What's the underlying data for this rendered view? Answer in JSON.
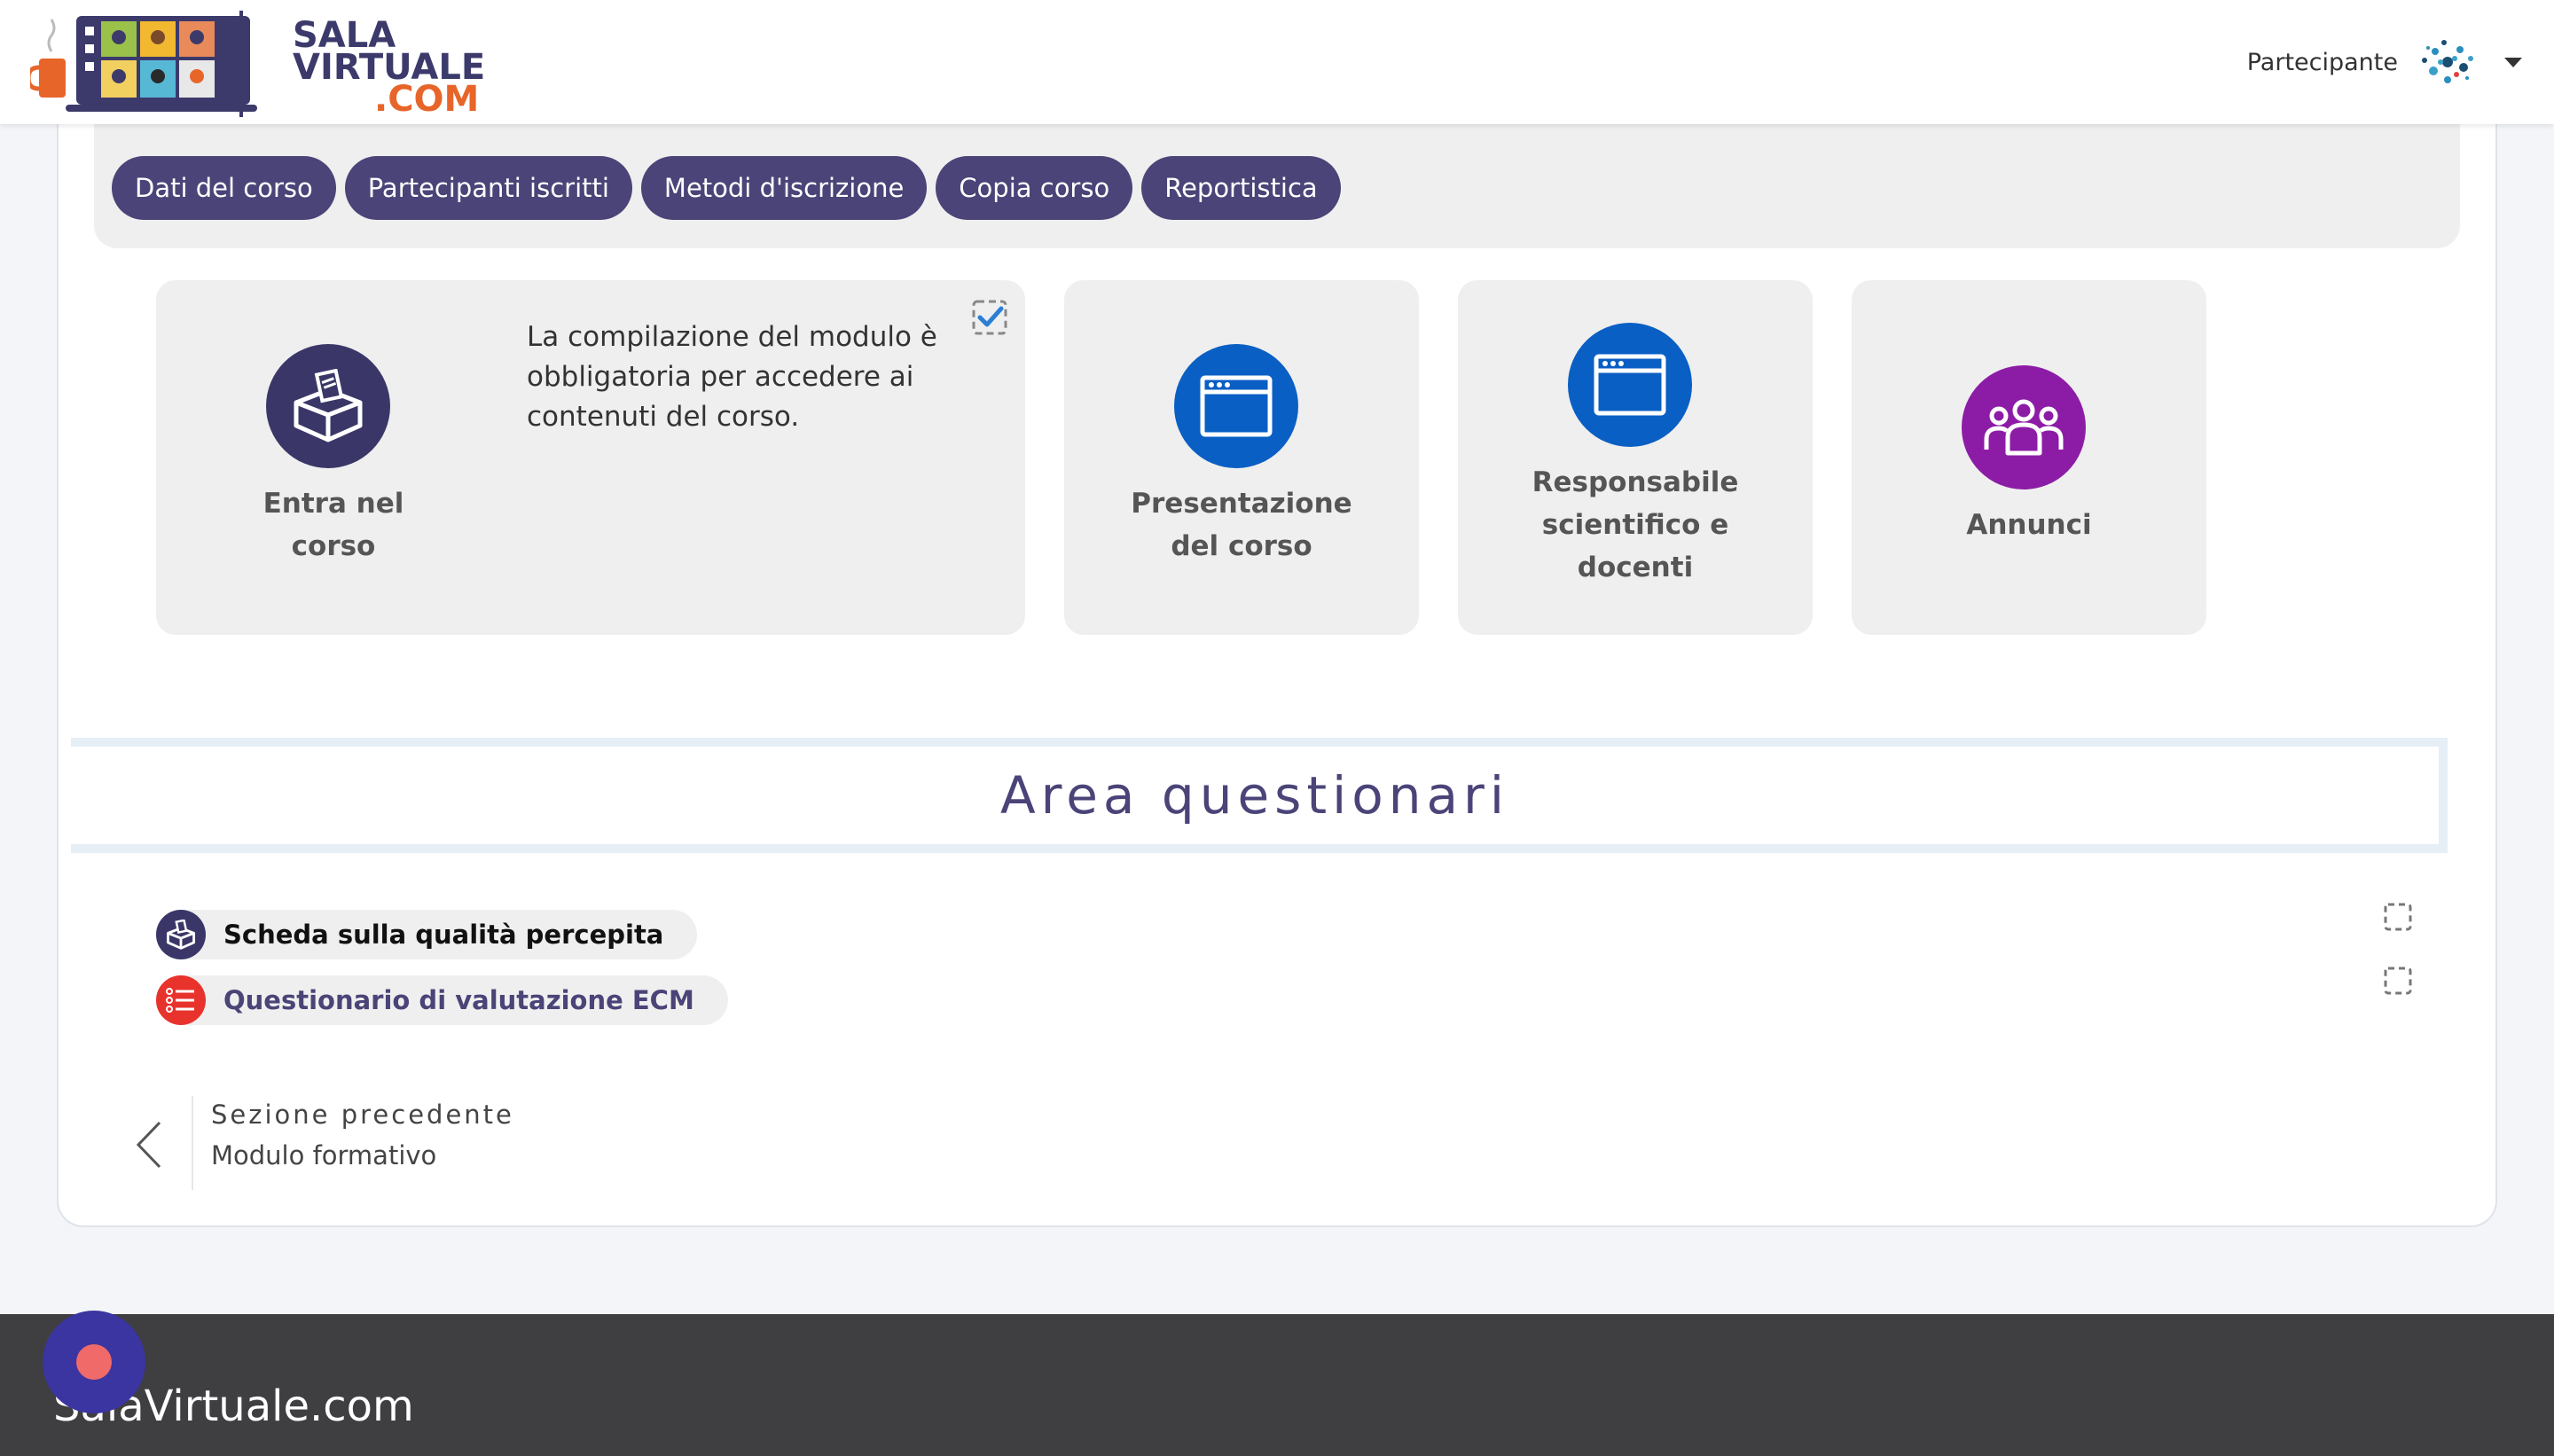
{
  "brand": {
    "line1": "SALA",
    "line2": "VIRTUALE",
    "line3": ".COM",
    "colors": {
      "primary": "#3c3a6b",
      "accent": "#e8652a"
    }
  },
  "user": {
    "role": "Partecipante",
    "avatar_icon": "network-avatar-icon",
    "menu_icon": "caret-down-icon"
  },
  "course_tabs": [
    {
      "label": "Dati del corso"
    },
    {
      "label": "Partecipanti iscritti"
    },
    {
      "label": "Metodi d'iscrizione"
    },
    {
      "label": "Copia corso"
    },
    {
      "label": "Reportistica"
    }
  ],
  "tiles": [
    {
      "label_line1": "Entra nel",
      "label_line2": "corso",
      "icon": "ballot-box-icon",
      "color": "#3a3768",
      "description": "La compilazione del modulo è obbligatoria per accedere ai contenuti del corso.",
      "completed": true
    },
    {
      "label_line1": "Presentazione",
      "label_line2": "del corso",
      "icon": "browser-window-icon",
      "color": "#0a5fc4"
    },
    {
      "label_line1": "Responsabile",
      "label_line2": "scientifico e",
      "label_line3": "docenti",
      "icon": "browser-window-icon",
      "color": "#0a5fc4"
    },
    {
      "label_line1": "Annunci",
      "icon": "group-icon",
      "color": "#8c1ca6"
    }
  ],
  "section": {
    "title": "Area questionari"
  },
  "activities": [
    {
      "name": "Scheda sulla qualità percepita",
      "icon": "ballot-box-icon",
      "color": "#3a3768",
      "text_color": "#111111"
    },
    {
      "name": "Questionario di valutazione ECM",
      "icon": "list-icon",
      "color": "#e8332c",
      "text_color": "#4a4478"
    }
  ],
  "prev_section": {
    "kicker": "Sezione precedente",
    "title": "Modulo formativo"
  },
  "footer": {
    "title": "SalaVirtuale.com"
  }
}
